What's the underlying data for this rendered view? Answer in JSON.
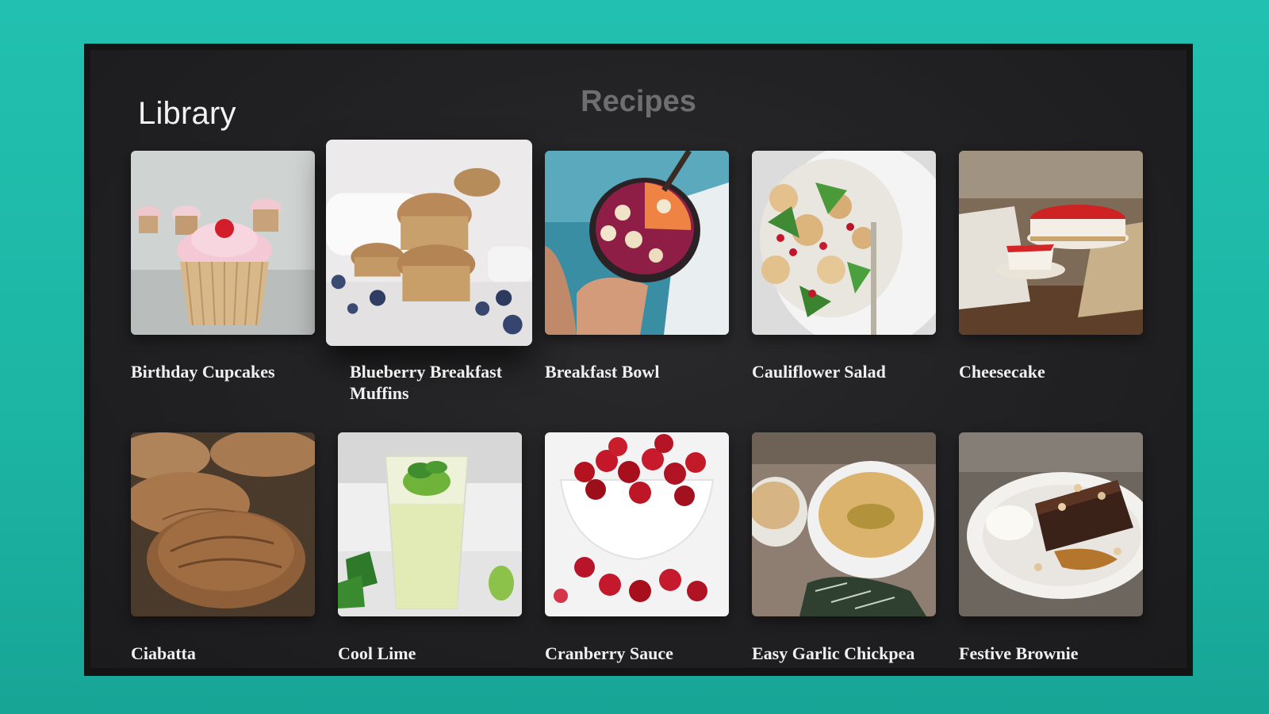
{
  "header": {
    "section_title": "Library",
    "center_title": "Recipes"
  },
  "recipes": [
    {
      "title": "Birthday Cupcakes",
      "image": "cupcakes-photo"
    },
    {
      "title": "Blueberry Breakfast Muffins",
      "image": "muffins-photo",
      "focused": true
    },
    {
      "title": "Breakfast Bowl",
      "image": "smoothie-bowl-photo"
    },
    {
      "title": "Cauliflower Salad",
      "image": "salad-photo"
    },
    {
      "title": "Cheesecake",
      "image": "cheesecake-photo"
    },
    {
      "title": "Ciabatta",
      "image": "bread-photo"
    },
    {
      "title": "Cool Lime",
      "image": "lime-drink-photo"
    },
    {
      "title": "Cranberry Sauce",
      "image": "cranberries-photo"
    },
    {
      "title": "Easy Garlic Chickpea Soup",
      "image": "soup-photo"
    },
    {
      "title": "Festive Brownie",
      "image": "brownie-photo"
    }
  ]
}
